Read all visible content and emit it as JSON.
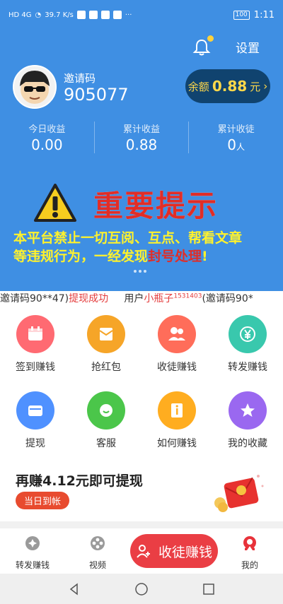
{
  "status": {
    "network": "HD 4G",
    "speed": "39.7 K/s",
    "battery": "100",
    "time": "1:11"
  },
  "header": {
    "settings_label": "设置",
    "invite_label": "邀请码",
    "invite_code": "905077",
    "balance_prefix": "余额",
    "balance_amount": "0.88",
    "balance_suffix": "元",
    "balance_chevron": "›"
  },
  "stats": [
    {
      "label": "今日收益",
      "value": "0.00",
      "unit": ""
    },
    {
      "label": "累计收益",
      "value": "0.88",
      "unit": ""
    },
    {
      "label": "累计收徒",
      "value": "0",
      "unit": "人"
    }
  ],
  "notice": {
    "title": "重要提示",
    "line1": "本平台禁止一切互阅、互点、帮看文章",
    "line2": "等违规行为，一经发现",
    "line2_red": "封号处理",
    "line2_end": "!"
  },
  "ticker": {
    "part1": "邀请码90**47)",
    "part1_red": "提现成功",
    "part2": "用户",
    "part2_red": "小瓶子",
    "part2_sup": "1531403",
    "part3": "(邀请码90*"
  },
  "grid": [
    {
      "label": "签到赚钱",
      "icon": "calendar-icon",
      "color": "#ff6a72"
    },
    {
      "label": "抢红包",
      "icon": "red-envelope-icon",
      "color": "#f6a528"
    },
    {
      "label": "收徒赚钱",
      "icon": "users-icon",
      "color": "#ff6d5a"
    },
    {
      "label": "转发赚钱",
      "icon": "yen-icon",
      "color": "#39c8ad"
    },
    {
      "label": "提现",
      "icon": "wallet-icon",
      "color": "#4f91ff"
    },
    {
      "label": "客服",
      "icon": "chat-icon",
      "color": "#4bc64a"
    },
    {
      "label": "如何赚钱",
      "icon": "info-icon",
      "color": "#ffad20"
    },
    {
      "label": "我的收藏",
      "icon": "star-icon",
      "color": "#9a68f0"
    }
  ],
  "banner": {
    "title": "再赚4.12元即可提现",
    "tag": "当日到帐"
  },
  "tabs": {
    "forward": "转发赚钱",
    "video": "视频",
    "invite": "收徒赚钱",
    "mine": "我的"
  },
  "colors": {
    "header_blue": "#3f8fe3",
    "accent_red": "#ea3e44",
    "gold": "#ffd84a"
  }
}
